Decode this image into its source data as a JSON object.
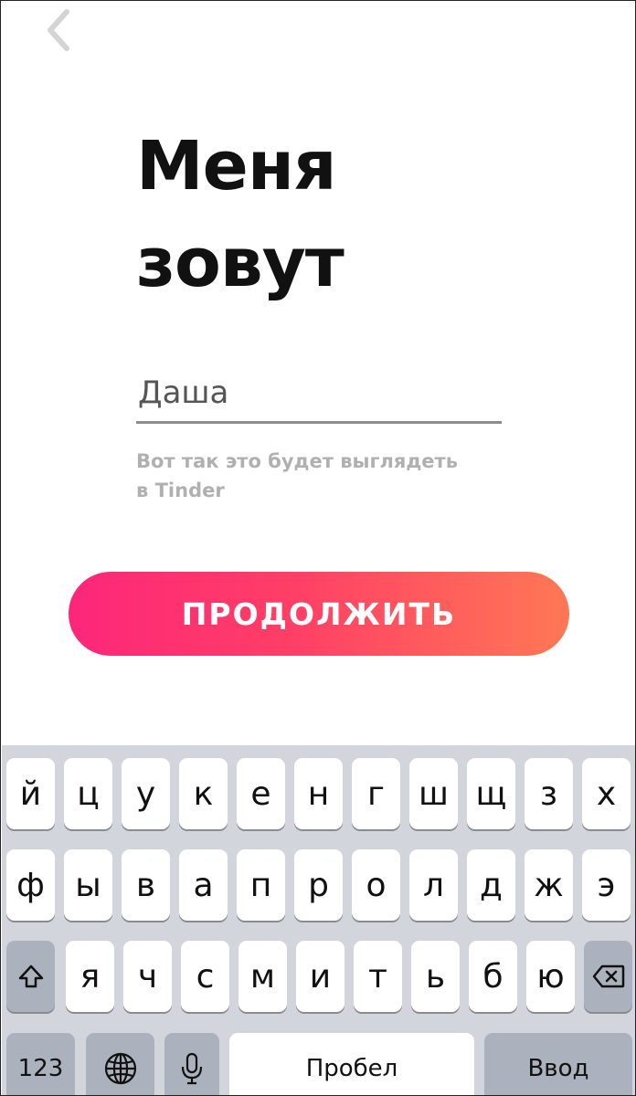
{
  "header": {
    "back_icon": "chevron-left-icon"
  },
  "title": {
    "line1": "Меня",
    "line2": "зовут"
  },
  "name_field": {
    "value": "Даша"
  },
  "hint": {
    "line1": "Вот так это будет выглядеть",
    "line2": "в Tinder"
  },
  "continue_button": {
    "label": "ПРОДОЛЖИТЬ"
  },
  "colors": {
    "gradient_start": "#fd267a",
    "gradient_end": "#ff7854",
    "keyboard_bg": "#d2d5db"
  },
  "keyboard": {
    "row1": [
      "й",
      "ц",
      "у",
      "к",
      "е",
      "н",
      "г",
      "ш",
      "щ",
      "з",
      "х"
    ],
    "row2": [
      "ф",
      "ы",
      "в",
      "а",
      "п",
      "р",
      "о",
      "л",
      "д",
      "ж",
      "э"
    ],
    "row3": [
      "я",
      "ч",
      "с",
      "м",
      "и",
      "т",
      "ь",
      "б",
      "ю"
    ],
    "numbers_label": "123",
    "space_label": "Пробел",
    "return_label": "Ввод",
    "icons": {
      "shift": "shift-icon",
      "backspace": "backspace-icon",
      "globe": "globe-icon",
      "mic": "microphone-icon"
    }
  }
}
